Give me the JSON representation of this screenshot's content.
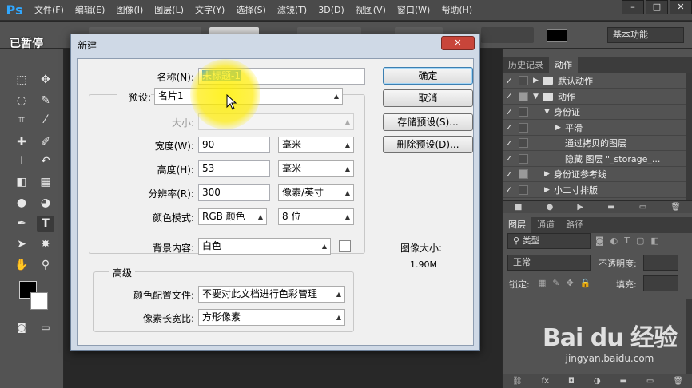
{
  "app": {
    "logo": "Ps",
    "paused_label": "已暂停"
  },
  "menu": [
    "文件(F)",
    "编辑(E)",
    "图像(I)",
    "图层(L)",
    "文字(Y)",
    "选择(S)",
    "滤镜(T)",
    "3D(D)",
    "视图(V)",
    "窗口(W)",
    "帮助(H)"
  ],
  "window_buttons": [
    "–",
    "□",
    "✕"
  ],
  "options": {
    "workspace": "基本功能"
  },
  "history_panel": {
    "tabs": [
      "历史记录",
      "动作"
    ],
    "active_tab": "动作",
    "rows": [
      {
        "label": "默认动作",
        "check": "✓",
        "box": "empty",
        "expand": "▶",
        "folder": true,
        "indent": 0
      },
      {
        "label": "动作",
        "check": "✓",
        "box": "filled",
        "expand": "▼",
        "folder": true,
        "indent": 0
      },
      {
        "label": "身份证",
        "check": "✓",
        "box": "empty",
        "expand": "▼",
        "folder": false,
        "indent": 1
      },
      {
        "label": "平滑",
        "check": "✓",
        "box": "empty",
        "expand": "▶",
        "folder": false,
        "indent": 2
      },
      {
        "label": "通过拷贝的图层",
        "check": "✓",
        "box": "empty",
        "expand": "",
        "folder": false,
        "indent": 2
      },
      {
        "label": "隐藏 图层 \"_storage_...",
        "check": "✓",
        "box": "empty",
        "expand": "",
        "folder": false,
        "indent": 2
      },
      {
        "label": "身份证参考线",
        "check": "✓",
        "box": "filled",
        "expand": "▶",
        "folder": false,
        "indent": 1
      },
      {
        "label": "小二寸排版",
        "check": "✓",
        "box": "empty",
        "expand": "▶",
        "folder": false,
        "indent": 1
      }
    ],
    "footer_icons": [
      "■",
      "●",
      "▶",
      "▬",
      "▭",
      "🗑"
    ]
  },
  "layers_panel": {
    "tabs": [
      "图层",
      "通道",
      "路径"
    ],
    "active_tab": "图层",
    "filter": "类型",
    "blend_mode": "正常",
    "opacity_label": "不透明度:",
    "lock_label": "锁定:",
    "fill_label": "填充:",
    "footer_icons": [
      "⛓",
      "fx",
      "◘",
      "◑",
      "▬",
      "▭",
      "🗑"
    ]
  },
  "watermark": {
    "logo": "Bai du 经验",
    "url": "jingyan.baidu.com"
  },
  "dialog": {
    "title": "新建",
    "close": "✕",
    "name_label": "名称(N):",
    "name_value": "未标题-1",
    "preset_label": "预设:",
    "preset_value": "名片1",
    "size_label": "大小:",
    "width_label": "宽度(W):",
    "width_value": "90",
    "width_unit": "毫米",
    "height_label": "高度(H):",
    "height_value": "53",
    "height_unit": "毫米",
    "resolution_label": "分辨率(R):",
    "resolution_value": "300",
    "resolution_unit": "像素/英寸",
    "color_mode_label": "颜色模式:",
    "color_mode_value": "RGB 颜色",
    "bit_depth": "8 位",
    "background_label": "背景内容:",
    "background_value": "白色",
    "advanced_label": "高级",
    "color_profile_label": "颜色配置文件:",
    "color_profile_value": "不要对此文档进行色彩管理",
    "pixel_aspect_label": "像素长宽比:",
    "pixel_aspect_value": "方形像素",
    "buttons": {
      "ok": "确定",
      "cancel": "取消",
      "save_preset": "存储预设(S)...",
      "delete_preset": "删除预设(D)..."
    },
    "image_size_label": "图像大小:",
    "image_size_value": "1.90M"
  }
}
